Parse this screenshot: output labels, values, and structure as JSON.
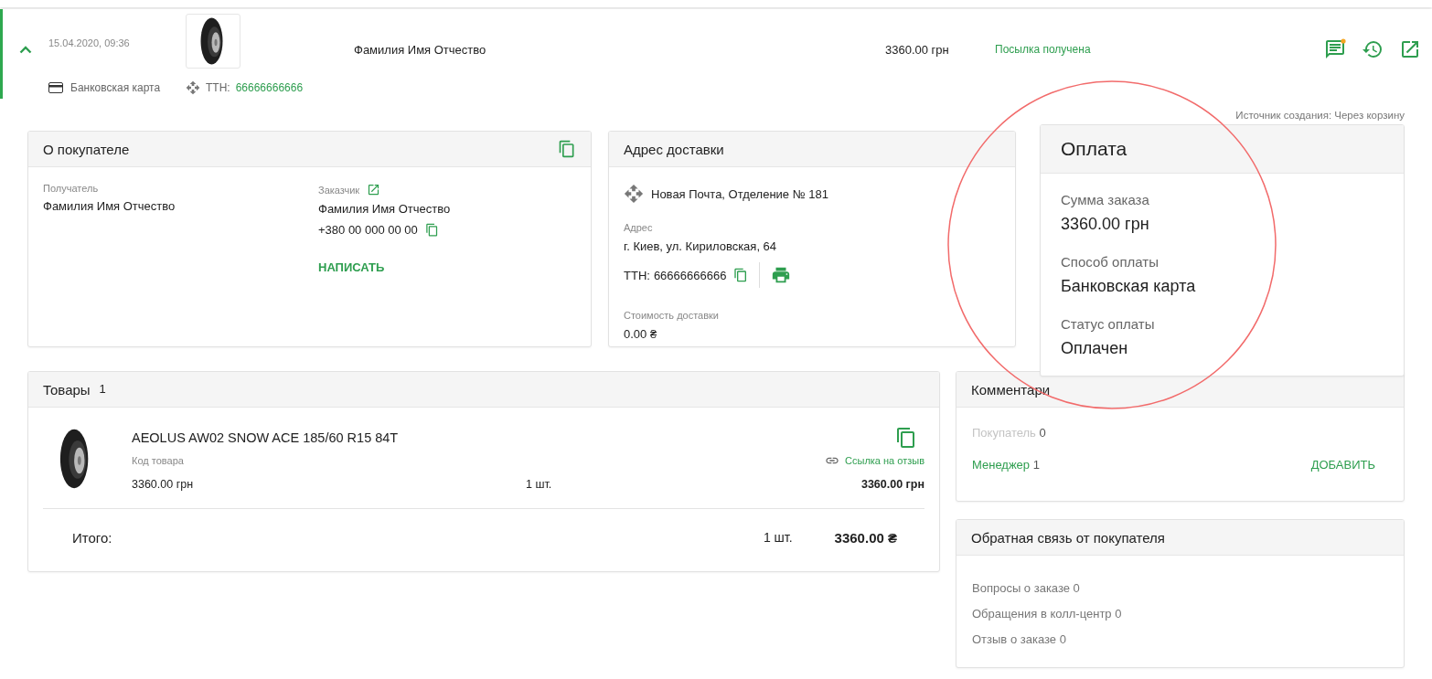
{
  "order": {
    "expanded": true,
    "date": "15.04.2020, 09:36",
    "payment_method": "Банковская карта",
    "ttn_label": "ТТН:",
    "ttn": "66666666666",
    "customer_name": "Фамилия Имя Отчество",
    "total": "3360.00 грн",
    "status": "Посылка получена",
    "new_comments": true
  },
  "source": "Источник создания: Через корзину",
  "buyer": {
    "title": "О покупателе",
    "recipient_label": "Получатель",
    "recipient": "Фамилия Имя Отчество",
    "customer_label": "Заказчик",
    "customer": "Фамилия Имя Отчество",
    "phone": "+380 00 000 00 00",
    "write_button": "НАПИСАТЬ"
  },
  "delivery": {
    "title": "Адрес доставки",
    "carrier": "Новая Почта, Отделение № 181",
    "address_label": "Адрес",
    "address": "г. Киев, ул. Кириловская, 64",
    "ttn_label": "ТТН:",
    "ttn": "66666666666",
    "cost_label": "Стоимость доставки",
    "cost": "0.00 ₴"
  },
  "payment": {
    "title": "Оплата",
    "fields": [
      {
        "label": "Сумма заказа",
        "value": "3360.00 грн"
      },
      {
        "label": "Способ оплаты",
        "value": "Банковская карта"
      },
      {
        "label": "Статус оплаты",
        "value": "Оплачен"
      }
    ]
  },
  "goods": {
    "title": "Товары",
    "count": "1",
    "items": [
      {
        "name": "AEOLUS AW02 SNOW ACE 185/60 R15 84T",
        "code_label": "Код товара",
        "review_link": "Ссылка на отзыв",
        "price": "3360.00 грн",
        "qty": "1 шт.",
        "total": "3360.00 грн"
      }
    ],
    "total_label": "Итого:",
    "total_qty": "1 шт.",
    "total_sum": "3360.00 ₴"
  },
  "comments": {
    "title": "Комментари",
    "tabs": [
      {
        "label": "Покупатель",
        "count": "0",
        "disabled": true
      },
      {
        "label": "Менеджер",
        "count": "1",
        "disabled": false
      }
    ],
    "add_button": "ДОБАВИТЬ"
  },
  "feedback": {
    "title": "Обратная связь от покупателя",
    "items": [
      "Вопросы о заказе 0",
      "Обращения в колл-центр 0",
      "Отзыв о заказе 0"
    ]
  }
}
